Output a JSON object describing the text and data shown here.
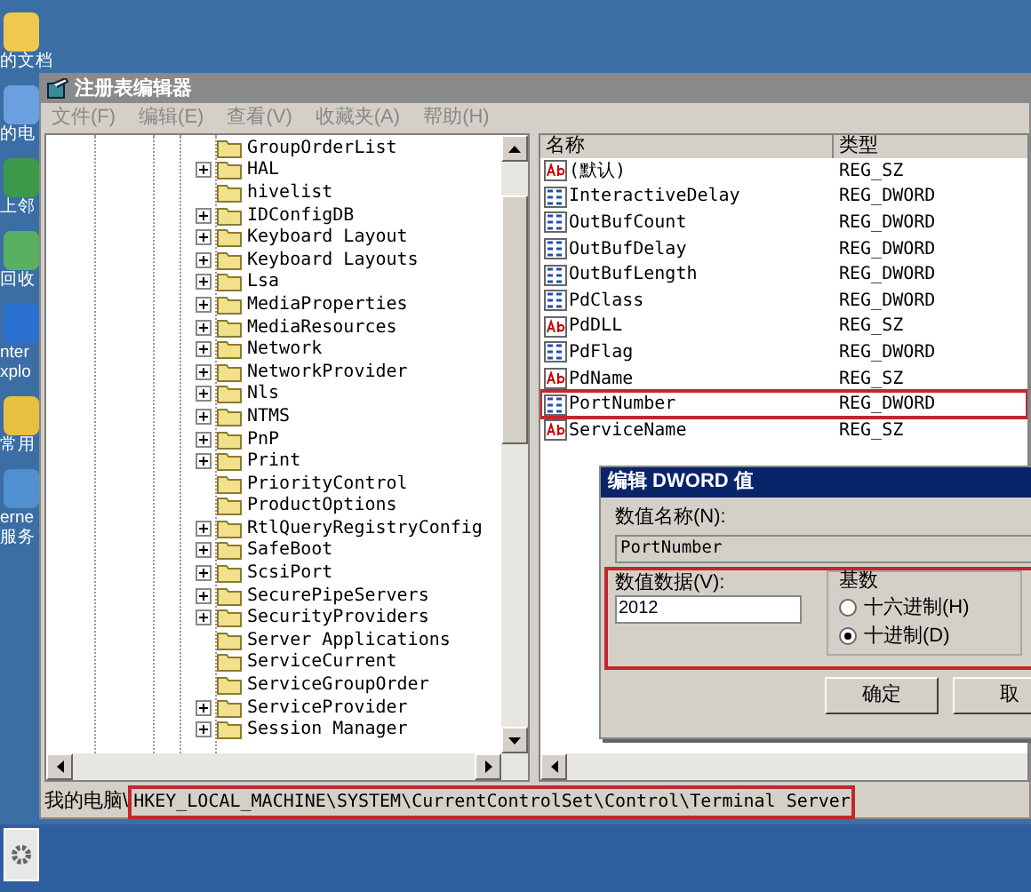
{
  "desktop_icons": [
    {
      "lines": [
        "的文档"
      ]
    },
    {
      "lines": [
        "的电"
      ]
    },
    {
      "lines": [
        "上邻"
      ]
    },
    {
      "lines": [
        "回收"
      ]
    },
    {
      "lines": [
        "nter",
        "xplo"
      ]
    },
    {
      "lines": [
        "常用"
      ]
    },
    {
      "lines": [
        "erne",
        "服务"
      ]
    }
  ],
  "window": {
    "title": "注册表编辑器"
  },
  "menu": [
    "文件(F)",
    "编辑(E)",
    "查看(V)",
    "收藏夹(A)",
    "帮助(H)"
  ],
  "tree": {
    "items": [
      {
        "label": "GroupOrderList",
        "expandable": false
      },
      {
        "label": "HAL",
        "expandable": true
      },
      {
        "label": "hivelist",
        "expandable": false
      },
      {
        "label": "IDConfigDB",
        "expandable": true
      },
      {
        "label": "Keyboard Layout",
        "expandable": true
      },
      {
        "label": "Keyboard Layouts",
        "expandable": true
      },
      {
        "label": "Lsa",
        "expandable": true
      },
      {
        "label": "MediaProperties",
        "expandable": true
      },
      {
        "label": "MediaResources",
        "expandable": true
      },
      {
        "label": "Network",
        "expandable": true
      },
      {
        "label": "NetworkProvider",
        "expandable": true
      },
      {
        "label": "Nls",
        "expandable": true
      },
      {
        "label": "NTMS",
        "expandable": true
      },
      {
        "label": "PnP",
        "expandable": true
      },
      {
        "label": "Print",
        "expandable": true
      },
      {
        "label": "PriorityControl",
        "expandable": false
      },
      {
        "label": "ProductOptions",
        "expandable": false
      },
      {
        "label": "RtlQueryRegistryConfig",
        "expandable": true
      },
      {
        "label": "SafeBoot",
        "expandable": true
      },
      {
        "label": "ScsiPort",
        "expandable": true
      },
      {
        "label": "SecurePipeServers",
        "expandable": true
      },
      {
        "label": "SecurityProviders",
        "expandable": true
      },
      {
        "label": "Server Applications",
        "expandable": false
      },
      {
        "label": "ServiceCurrent",
        "expandable": false
      },
      {
        "label": "ServiceGroupOrder",
        "expandable": false
      },
      {
        "label": "ServiceProvider",
        "expandable": true
      },
      {
        "label": "Session Manager",
        "expandable": true
      }
    ]
  },
  "values": {
    "columns": [
      "名称",
      "类型"
    ],
    "rows": [
      {
        "name": "(默认)",
        "type": "REG_SZ",
        "kind": "string",
        "highlighted": false
      },
      {
        "name": "InteractiveDelay",
        "type": "REG_DWORD",
        "kind": "binary",
        "highlighted": false
      },
      {
        "name": "OutBufCount",
        "type": "REG_DWORD",
        "kind": "binary",
        "highlighted": false
      },
      {
        "name": "OutBufDelay",
        "type": "REG_DWORD",
        "kind": "binary",
        "highlighted": false
      },
      {
        "name": "OutBufLength",
        "type": "REG_DWORD",
        "kind": "binary",
        "highlighted": false
      },
      {
        "name": "PdClass",
        "type": "REG_DWORD",
        "kind": "binary",
        "highlighted": false
      },
      {
        "name": "PdDLL",
        "type": "REG_SZ",
        "kind": "string",
        "highlighted": false
      },
      {
        "name": "PdFlag",
        "type": "REG_DWORD",
        "kind": "binary",
        "highlighted": false
      },
      {
        "name": "PdName",
        "type": "REG_SZ",
        "kind": "string",
        "highlighted": false
      },
      {
        "name": "PortNumber",
        "type": "REG_DWORD",
        "kind": "binary",
        "highlighted": true
      },
      {
        "name": "ServiceName",
        "type": "REG_SZ",
        "kind": "string",
        "highlighted": false
      }
    ]
  },
  "dialog": {
    "title": "编辑 DWORD 值",
    "name_label": "数值名称(N):",
    "name_value": "PortNumber",
    "data_label": "数值数据(V):",
    "data_value": "2012",
    "base_label": "基数",
    "data_highlighted": true,
    "radios": [
      {
        "label": "十六进制(H)",
        "selected": false
      },
      {
        "label": "十进制(D)",
        "selected": true
      }
    ],
    "buttons": [
      "确定",
      "取"
    ]
  },
  "status_bar": {
    "prefix": "我的电脑\\",
    "path": "HKEY_LOCAL_MACHINE\\SYSTEM\\CurrentControlSet\\Control\\Terminal Server",
    "highlighted": true
  }
}
